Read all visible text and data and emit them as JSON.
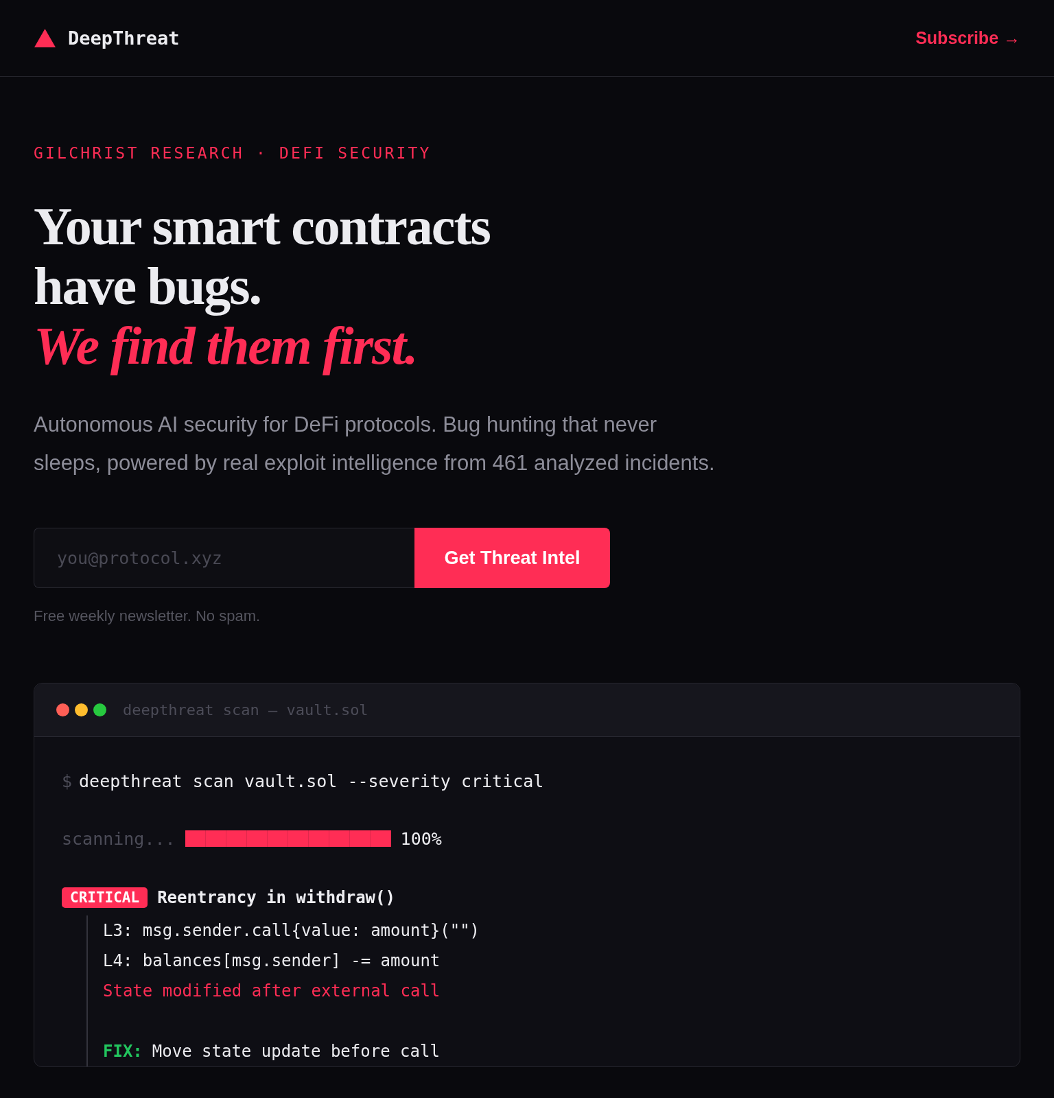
{
  "header": {
    "brand": "DeepThreat",
    "subscribe": "Subscribe →"
  },
  "hero": {
    "kicker": "GILCHRIST RESEARCH · DEFI SECURITY",
    "headline_lines": [
      "Your smart contracts",
      "have bugs."
    ],
    "headline_accent": "We find them first.",
    "description": "Autonomous AI security for DeFi protocols. Bug hunting that never sleeps, powered by real exploit intelligence from 461 analyzed incidents.",
    "email": {
      "placeholder": "you@protocol.xyz"
    },
    "button": "Get Threat Intel",
    "note": "Free weekly newsletter. No spam."
  },
  "terminal": {
    "title": "deepthreat scan — vault.sol",
    "command": {
      "prompt": "$",
      "text": "deepthreat scan vault.sol --severity critical"
    },
    "progress": {
      "label": "scanning...",
      "level": 1,
      "reading": "100%"
    },
    "finding": {
      "severity": "CRITICAL",
      "title": "Reentrancy in withdraw()",
      "lines": [
        {
          "kind": "code",
          "text": "L3: msg.sender.call{value: amount}(\"\")"
        },
        {
          "kind": "code",
          "text": "L4: balances[msg.sender] -= amount"
        },
        {
          "kind": "warning",
          "text": "State modified after external call"
        },
        {
          "kind": "blank"
        },
        {
          "kind": "fix",
          "label": "FIX:",
          "text": "Move state update before call"
        }
      ]
    }
  }
}
